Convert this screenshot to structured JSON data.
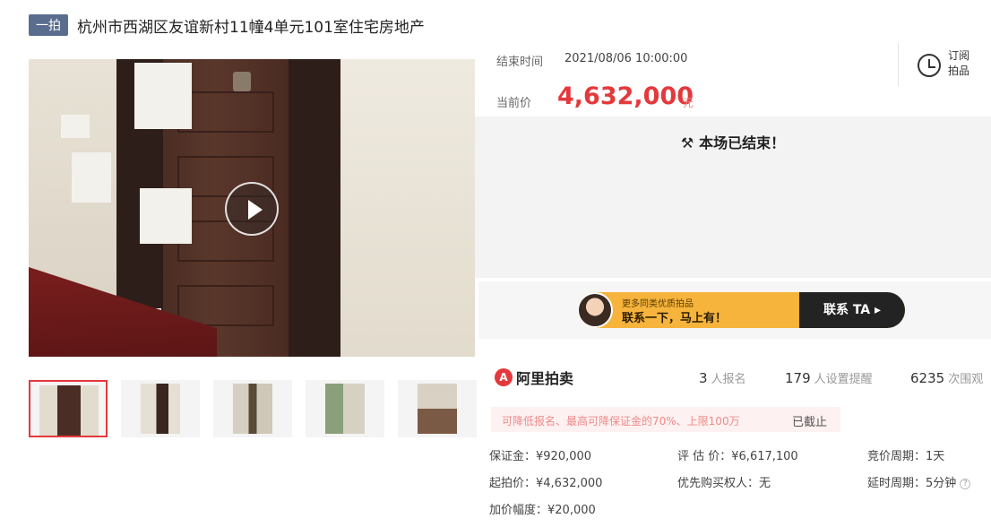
{
  "header": {
    "tag": "一拍",
    "title": "杭州市西湖区友谊新村11幢4单元101室住宅房地产"
  },
  "info": {
    "end_label": "结束时间",
    "end_value": "2021/08/06 10:00:00",
    "price_label": "当前价",
    "price_value": "4,632,000",
    "price_unit": "元"
  },
  "subscribe": {
    "label": "订阅拍品"
  },
  "status": {
    "ended_text": "本场已结束！"
  },
  "contact": {
    "line1": "更多同类优质拍品",
    "line2": "联系一下，马上有！",
    "button": "联系 TA ▸"
  },
  "brand": {
    "logo": "A",
    "name": "阿里拍卖"
  },
  "stats": [
    {
      "num": "3",
      "label": "人报名"
    },
    {
      "num": "179",
      "label": "人设置提醒"
    },
    {
      "num": "6235",
      "label": "次围观"
    }
  ],
  "notice": {
    "text": "可降低报名、最高可降保证金的70%、上限100万",
    "status": "已截止"
  },
  "details": {
    "deposit": "保证金：¥920,000",
    "appraisal": "评 估 价：¥6,617,100",
    "cycle": "竞价周期：1天",
    "start_price": "起拍价：¥4,632,000",
    "priority": "优先购买权人：无",
    "delay": "延时周期：5分钟",
    "increment": "加价幅度：¥20,000"
  },
  "colors": {
    "accent": "#e4393c",
    "tag_bg": "#5b6d8f",
    "contact_bg": "#f6b43c"
  },
  "icons": {
    "play": "play-icon",
    "clock": "alarm-clock-icon",
    "hammer": "auction-hammer-icon"
  }
}
